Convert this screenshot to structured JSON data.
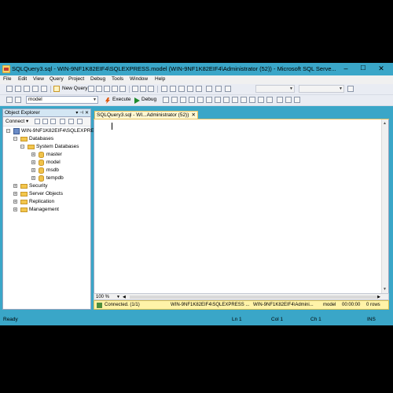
{
  "window": {
    "title": "SQLQuery3.sql - WIN-9NF1K82EIF4\\SQLEXPRESS.model (WIN-9NF1K82EIF4\\Administrator (52)) - Microsoft SQL Serve...",
    "controls": {
      "minimize": "–",
      "maximize": "☐",
      "close": "✕"
    },
    "accent_color": "#3aa6c8"
  },
  "menu": [
    "File",
    "Edit",
    "View",
    "Query",
    "Project",
    "Debug",
    "Tools",
    "Window",
    "Help"
  ],
  "toolbar1": {
    "new_query_label": "New Query"
  },
  "toolbar2": {
    "database_value": "model",
    "execute_label": "Execute",
    "debug_label": "Debug"
  },
  "object_explorer": {
    "title": "Object Explorer",
    "connect_label": "Connect ▾",
    "tree": {
      "server": "WIN-9NF1K82EIF4\\SQLEXPRESS",
      "databases": "Databases",
      "system_databases": "System Databases",
      "db_items": [
        "master",
        "model",
        "msdb",
        "tempdb"
      ],
      "other_folders": [
        "Security",
        "Server Objects",
        "Replication",
        "Management"
      ]
    }
  },
  "editor": {
    "tab_label": "SQLQuery3.sql - WI...Administrator (52))",
    "tab_close": "✕",
    "zoom": "100 %"
  },
  "query_status": {
    "connected": "Connected. (1/1)",
    "server": "WIN-9NF1K82EIF4\\SQLEXPRESS ...",
    "user": "WIN-9NF1K82EIF4\\Admini...",
    "database": "model",
    "elapsed": "00:00:00",
    "rows": "0 rows"
  },
  "status_bar": {
    "state": "Ready",
    "line": "Ln 1",
    "col": "Col 1",
    "ch": "Ch 1",
    "mode": "INS"
  }
}
